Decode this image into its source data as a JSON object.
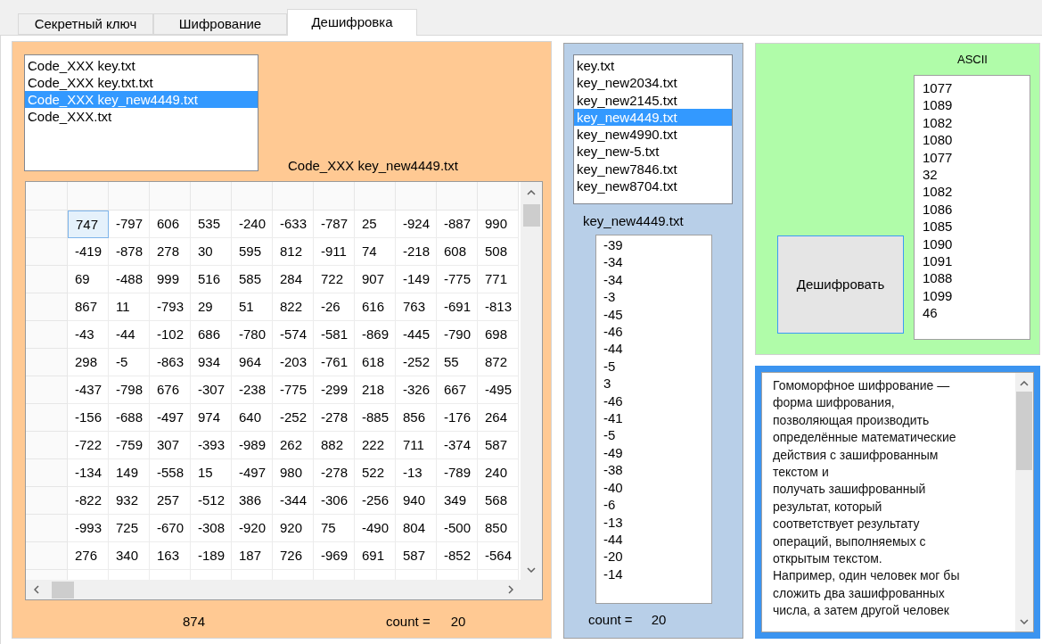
{
  "tabs": [
    {
      "label": "Секретный ключ",
      "selected": false
    },
    {
      "label": "Шифрование",
      "selected": false
    },
    {
      "label": "Дешифровка",
      "selected": true
    }
  ],
  "files_list": {
    "items": [
      {
        "label": "Code_XXX key.txt",
        "selected": false
      },
      {
        "label": "Code_XXX key.txt.txt",
        "selected": false
      },
      {
        "label": "Code_XXX key_new4449.txt",
        "selected": true
      },
      {
        "label": "Code_XXX.txt",
        "selected": false
      }
    ]
  },
  "selected_file_label": "Code_XXX key_new4449.txt",
  "grid": {
    "rows": [
      [
        {
          "text": "747",
          "selected": true
        },
        {
          "text": "-797",
          "selected": false
        },
        {
          "text": "606",
          "selected": false
        },
        {
          "text": "535",
          "selected": false
        },
        {
          "text": "-240",
          "selected": false
        },
        {
          "text": "-633",
          "selected": false
        },
        {
          "text": "-787",
          "selected": false
        },
        {
          "text": "25",
          "selected": false
        },
        {
          "text": "-924",
          "selected": false
        },
        {
          "text": "-887",
          "selected": false
        },
        {
          "text": "990",
          "selected": false
        }
      ],
      [
        {
          "text": "-419",
          "selected": false
        },
        {
          "text": "-878",
          "selected": false
        },
        {
          "text": "278",
          "selected": false
        },
        {
          "text": "30",
          "selected": false
        },
        {
          "text": "595",
          "selected": false
        },
        {
          "text": "812",
          "selected": false
        },
        {
          "text": "-911",
          "selected": false
        },
        {
          "text": "74",
          "selected": false
        },
        {
          "text": "-218",
          "selected": false
        },
        {
          "text": "608",
          "selected": false
        },
        {
          "text": "508",
          "selected": false
        }
      ],
      [
        {
          "text": "69",
          "selected": false
        },
        {
          "text": "-488",
          "selected": false
        },
        {
          "text": "999",
          "selected": false
        },
        {
          "text": "516",
          "selected": false
        },
        {
          "text": "585",
          "selected": false
        },
        {
          "text": "284",
          "selected": false
        },
        {
          "text": "722",
          "selected": false
        },
        {
          "text": "907",
          "selected": false
        },
        {
          "text": "-149",
          "selected": false
        },
        {
          "text": "-775",
          "selected": false
        },
        {
          "text": "771",
          "selected": false
        }
      ],
      [
        {
          "text": "867",
          "selected": false
        },
        {
          "text": "11",
          "selected": false
        },
        {
          "text": "-793",
          "selected": false
        },
        {
          "text": "29",
          "selected": false
        },
        {
          "text": "51",
          "selected": false
        },
        {
          "text": "822",
          "selected": false
        },
        {
          "text": "-26",
          "selected": false
        },
        {
          "text": "616",
          "selected": false
        },
        {
          "text": "763",
          "selected": false
        },
        {
          "text": "-691",
          "selected": false
        },
        {
          "text": "-813",
          "selected": false
        }
      ],
      [
        {
          "text": "-43",
          "selected": false
        },
        {
          "text": "-44",
          "selected": false
        },
        {
          "text": "-102",
          "selected": false
        },
        {
          "text": "686",
          "selected": false
        },
        {
          "text": "-780",
          "selected": false
        },
        {
          "text": "-574",
          "selected": false
        },
        {
          "text": "-581",
          "selected": false
        },
        {
          "text": "-869",
          "selected": false
        },
        {
          "text": "-445",
          "selected": false
        },
        {
          "text": "-790",
          "selected": false
        },
        {
          "text": "698",
          "selected": false
        }
      ],
      [
        {
          "text": "298",
          "selected": false
        },
        {
          "text": "-5",
          "selected": false
        },
        {
          "text": "-863",
          "selected": false
        },
        {
          "text": "934",
          "selected": false
        },
        {
          "text": "964",
          "selected": false
        },
        {
          "text": "-203",
          "selected": false
        },
        {
          "text": "-761",
          "selected": false
        },
        {
          "text": "618",
          "selected": false
        },
        {
          "text": "-252",
          "selected": false
        },
        {
          "text": "55",
          "selected": false
        },
        {
          "text": "872",
          "selected": false
        }
      ],
      [
        {
          "text": "-437",
          "selected": false
        },
        {
          "text": "-798",
          "selected": false
        },
        {
          "text": "676",
          "selected": false
        },
        {
          "text": "-307",
          "selected": false
        },
        {
          "text": "-238",
          "selected": false
        },
        {
          "text": "-775",
          "selected": false
        },
        {
          "text": "-299",
          "selected": false
        },
        {
          "text": "218",
          "selected": false
        },
        {
          "text": "-326",
          "selected": false
        },
        {
          "text": "667",
          "selected": false
        },
        {
          "text": "-495",
          "selected": false
        }
      ],
      [
        {
          "text": "-156",
          "selected": false
        },
        {
          "text": "-688",
          "selected": false
        },
        {
          "text": "-497",
          "selected": false
        },
        {
          "text": "974",
          "selected": false
        },
        {
          "text": "640",
          "selected": false
        },
        {
          "text": "-252",
          "selected": false
        },
        {
          "text": "-278",
          "selected": false
        },
        {
          "text": "-885",
          "selected": false
        },
        {
          "text": "856",
          "selected": false
        },
        {
          "text": "-176",
          "selected": false
        },
        {
          "text": "264",
          "selected": false
        }
      ],
      [
        {
          "text": "-722",
          "selected": false
        },
        {
          "text": "-759",
          "selected": false
        },
        {
          "text": "307",
          "selected": false
        },
        {
          "text": "-393",
          "selected": false
        },
        {
          "text": "-989",
          "selected": false
        },
        {
          "text": "262",
          "selected": false
        },
        {
          "text": "882",
          "selected": false
        },
        {
          "text": "222",
          "selected": false
        },
        {
          "text": "711",
          "selected": false
        },
        {
          "text": "-374",
          "selected": false
        },
        {
          "text": "587",
          "selected": false
        }
      ],
      [
        {
          "text": "-134",
          "selected": false
        },
        {
          "text": "149",
          "selected": false
        },
        {
          "text": "-558",
          "selected": false
        },
        {
          "text": "15",
          "selected": false
        },
        {
          "text": "-497",
          "selected": false
        },
        {
          "text": "980",
          "selected": false
        },
        {
          "text": "-278",
          "selected": false
        },
        {
          "text": "522",
          "selected": false
        },
        {
          "text": "-13",
          "selected": false
        },
        {
          "text": "-789",
          "selected": false
        },
        {
          "text": "240",
          "selected": false
        }
      ],
      [
        {
          "text": "-822",
          "selected": false
        },
        {
          "text": "932",
          "selected": false
        },
        {
          "text": "257",
          "selected": false
        },
        {
          "text": "-512",
          "selected": false
        },
        {
          "text": "386",
          "selected": false
        },
        {
          "text": "-344",
          "selected": false
        },
        {
          "text": "-306",
          "selected": false
        },
        {
          "text": "-256",
          "selected": false
        },
        {
          "text": "940",
          "selected": false
        },
        {
          "text": "349",
          "selected": false
        },
        {
          "text": "568",
          "selected": false
        }
      ],
      [
        {
          "text": "-993",
          "selected": false
        },
        {
          "text": "725",
          "selected": false
        },
        {
          "text": "-670",
          "selected": false
        },
        {
          "text": "-308",
          "selected": false
        },
        {
          "text": "-920",
          "selected": false
        },
        {
          "text": "920",
          "selected": false
        },
        {
          "text": "75",
          "selected": false
        },
        {
          "text": "-490",
          "selected": false
        },
        {
          "text": "804",
          "selected": false
        },
        {
          "text": "-500",
          "selected": false
        },
        {
          "text": "850",
          "selected": false
        }
      ],
      [
        {
          "text": "276",
          "selected": false
        },
        {
          "text": "340",
          "selected": false
        },
        {
          "text": "163",
          "selected": false
        },
        {
          "text": "-189",
          "selected": false
        },
        {
          "text": "187",
          "selected": false
        },
        {
          "text": "726",
          "selected": false
        },
        {
          "text": "-969",
          "selected": false
        },
        {
          "text": "691",
          "selected": false
        },
        {
          "text": "587",
          "selected": false
        },
        {
          "text": "-852",
          "selected": false
        },
        {
          "text": "-564",
          "selected": false
        }
      ]
    ]
  },
  "grid_footer": {
    "value": "874",
    "count_label": "count =",
    "count": "20"
  },
  "keys_list": {
    "items": [
      {
        "label": "key.txt",
        "selected": false
      },
      {
        "label": "key_new2034.txt",
        "selected": false
      },
      {
        "label": "key_new2145.txt",
        "selected": false
      },
      {
        "label": "key_new4449.txt",
        "selected": true
      },
      {
        "label": "key_new4990.txt",
        "selected": false
      },
      {
        "label": "key_new-5.txt",
        "selected": false
      },
      {
        "label": "key_new7846.txt",
        "selected": false
      },
      {
        "label": "key_new8704.txt",
        "selected": false
      }
    ]
  },
  "selected_key_label": "key_new4449.txt",
  "key_values": [
    "-39",
    "-34",
    "-34",
    "-3",
    "-45",
    "-46",
    "-44",
    "-5",
    "3",
    "-46",
    "-41",
    "-5",
    "-49",
    "-38",
    "-40",
    "-6",
    "-13",
    "-44",
    "-20",
    "-14"
  ],
  "key_footer": {
    "count_label": "count =",
    "count": "20"
  },
  "ascii_label": "ASCII",
  "ascii_values": [
    "1077",
    "1089",
    "1082",
    "1080",
    "1077",
    "32",
    "1082",
    "1086",
    "1085",
    "1090",
    "1091",
    "1088",
    "1099",
    "46"
  ],
  "decrypt_button": "Дешифровать",
  "info_text_lines": [
    "Гомоморфное шифрование —",
    "форма шифрования,",
    "позволяющая производить",
    "определённые математические",
    "действия с зашифрованным",
    "текстом и",
    "получать зашифрованный",
    "результат, который",
    "соответствует результату",
    "операций, выполняемых с",
    "открытым текстом.",
    "Например, один человек мог бы",
    "сложить два зашифрованных",
    "числа, а затем другой человек"
  ]
}
